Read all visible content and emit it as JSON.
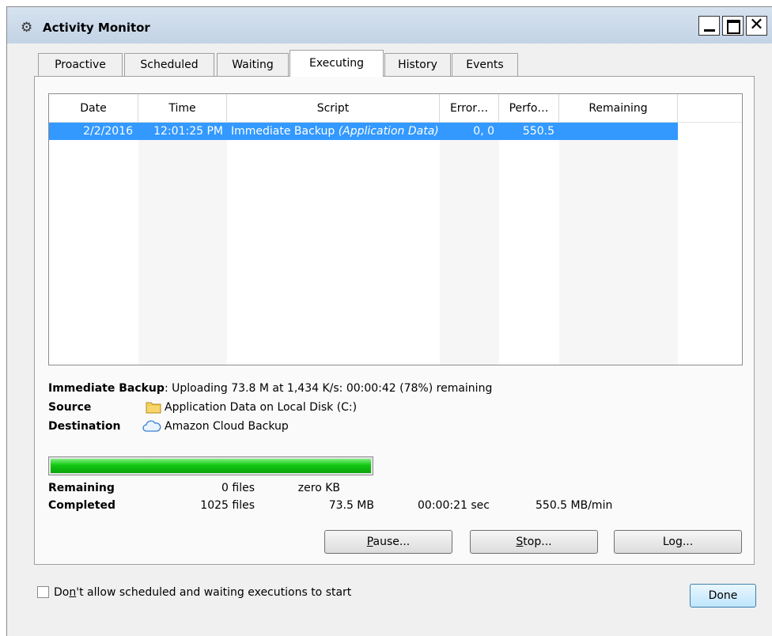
{
  "window": {
    "title": "Activity Monitor",
    "app_icon": "gear-icon",
    "controls": [
      "minimize",
      "maximize",
      "close"
    ]
  },
  "tabs": [
    {
      "label": "Proactive"
    },
    {
      "label": "Scheduled"
    },
    {
      "label": "Waiting"
    },
    {
      "label": "Executing",
      "active": true
    },
    {
      "label": "History"
    },
    {
      "label": "Events"
    }
  ],
  "table": {
    "columns": [
      "Date",
      "Time",
      "Script",
      "Error…",
      "Perfo…",
      "Remaining"
    ],
    "rows": [
      {
        "date": "2/2/2016",
        "time": "12:01:25 PM",
        "script_name": "Immediate Backup",
        "script_set": "(Application Data)",
        "errors": "0, 0",
        "performance": "550.5",
        "remaining": "",
        "selected": true
      }
    ]
  },
  "status": {
    "task": "Immediate Backup",
    "message": ": Uploading 73.8 M at 1,434 K/s: 00:00:42 (78%) remaining",
    "source_label": "Source",
    "source_value": "Application Data on Local Disk (C:)",
    "source_icon": "folder-icon",
    "destination_label": "Destination",
    "destination_value": "Amazon Cloud Backup",
    "destination_icon": "cloud-icon"
  },
  "progress": {
    "percent": 100,
    "color": "#12c812"
  },
  "stats": {
    "remaining": {
      "label": "Remaining",
      "files": "0 files",
      "size": "zero KB"
    },
    "completed": {
      "label": "Completed",
      "files": "1025 files",
      "size": "73.5 MB",
      "time": "00:00:21 sec",
      "rate": "550.5 MB/min"
    }
  },
  "buttons": {
    "pause": {
      "mnemonic": "P",
      "rest": "ause..."
    },
    "stop": {
      "mnemonic": "S",
      "rest": "top..."
    },
    "log": {
      "pre": "Lo",
      "mnemonic": "g",
      "rest": "..."
    },
    "done": "Done"
  },
  "checkbox": {
    "pre": "Do",
    "mnemonic": "n",
    "rest": "'t allow scheduled and waiting executions to start",
    "checked": false
  },
  "colors": {
    "selection": "#3399ff",
    "title_bar": "#c3d3e6"
  }
}
